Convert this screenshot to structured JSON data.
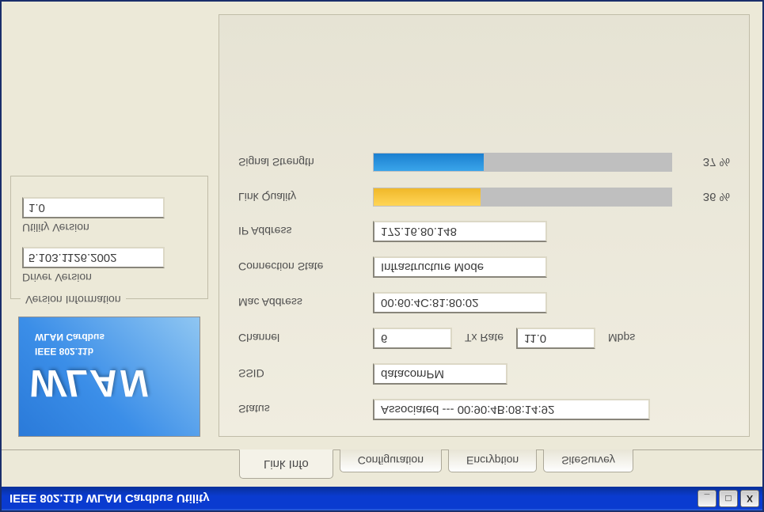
{
  "window": {
    "title": "IEEE 802.11b WLAN Cardbus Utility"
  },
  "tabs": {
    "link_info": "Link Info",
    "configuration": "Configuration",
    "encryption": "Encryption",
    "site_survey": "SiteSurvey"
  },
  "logo": {
    "main": "WLAN",
    "line1": "IEEE 802.11b",
    "line2": "WLAN Cardbus"
  },
  "version_info": {
    "title": "Version Information",
    "driver_label": "Driver Version",
    "driver_value": "5.103.1126.2002",
    "utility_label": "Utility Version",
    "utility_value": "1.0"
  },
  "link": {
    "labels": {
      "status": "Status",
      "ssid": "SSID",
      "channel": "Channel",
      "tx_rate": "Tx Rate",
      "unit": "Mbps",
      "mac": "Mac Address",
      "conn_state": "Connection State",
      "ip": "IP Address",
      "link_quality": "Link Quality",
      "signal_strength": "Signal Strength"
    },
    "status": "Associated --- 00:90:4B:08:14:92",
    "ssid": "datacomPM",
    "channel": "6",
    "tx_rate": "11.0",
    "mac": "00:60:4C:81:80:02",
    "conn_state": "Infrastructure Mode",
    "ip": "172.16.80.148",
    "link_quality_pct": "36 %",
    "link_quality_width": "36%",
    "signal_strength_pct": "37 %",
    "signal_strength_width": "37%"
  }
}
